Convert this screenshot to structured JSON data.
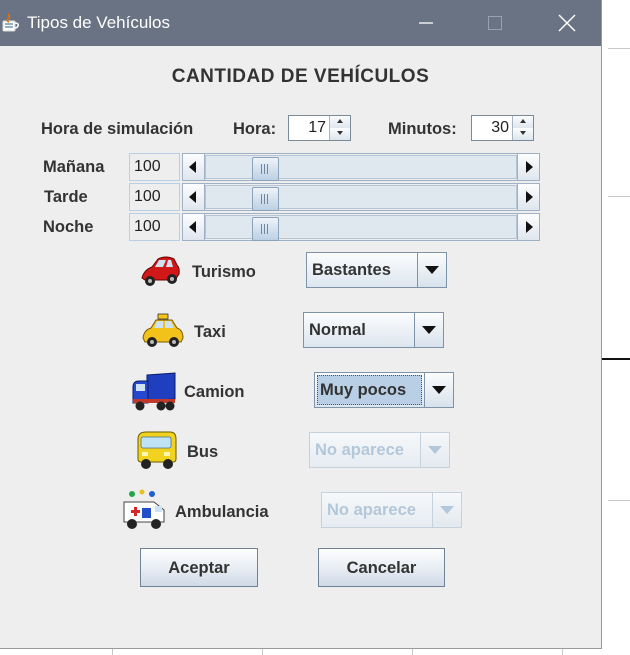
{
  "window": {
    "title": "Tipos de Vehículos"
  },
  "heading": "CANTIDAD DE VEHÍCULOS",
  "simulation": {
    "label": "Hora de simulación",
    "hour_label": "Hora:",
    "hour_value": "17",
    "minutes_label": "Minutos:",
    "minutes_value": "30"
  },
  "periods": [
    {
      "label": "Mañana",
      "value": "100"
    },
    {
      "label": "Tarde",
      "value": "100"
    },
    {
      "label": "Noche",
      "value": "100"
    }
  ],
  "vehicles": [
    {
      "label": "Turismo",
      "icon": "car-icon",
      "selected": "Bastantes",
      "enabled": true
    },
    {
      "label": "Taxi",
      "icon": "taxi-icon",
      "selected": "Normal",
      "enabled": true
    },
    {
      "label": "Camion",
      "icon": "truck-icon",
      "selected": "Muy pocos",
      "enabled": true
    },
    {
      "label": "Bus",
      "icon": "bus-icon",
      "selected": "No aparece",
      "enabled": false
    },
    {
      "label": "Ambulancia",
      "icon": "ambulance-icon",
      "selected": "No aparece",
      "enabled": false
    }
  ],
  "buttons": {
    "accept": "Aceptar",
    "cancel": "Cancelar"
  },
  "colors": {
    "titlebar": "#697384",
    "window_bg": "#eeeeee",
    "combo_focus": "#b8cfe5",
    "disabled_text": "#b3c7da"
  }
}
